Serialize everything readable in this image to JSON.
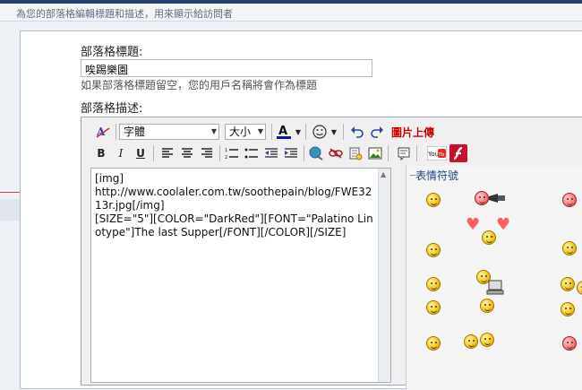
{
  "header": {
    "description": "為您的部落格編輯標題和描述，用來顯示給訪問者"
  },
  "form": {
    "title_label": "部落格標題:",
    "title_value": "唉踢樂園",
    "title_hint": "如果部落格標題留空，您的用戶名稱將會作為標題",
    "desc_label": "部落格描述:"
  },
  "toolbar": {
    "font_value": "字體",
    "size_value": "大小",
    "image_upload": "圖片上傳",
    "bold": "B",
    "italic": "I",
    "underline": "U",
    "font_color_glyph": "A"
  },
  "editor": {
    "content": "[img]\nhttp://www.coolaler.com.tw/soothepain/blog/FWE3213r.jpg[/img]\n[SIZE=\"5\"][COLOR=\"DarkRed\"][FONT=\"Palatino Linotype\"]The last Supper[/FONT][/COLOR][/SIZE]"
  },
  "emoticons": {
    "title": "表情符號"
  },
  "icons": {
    "spell": "spellcheck-icon",
    "undo": "undo-icon",
    "redo": "redo-icon",
    "smiley": "smiley-icon",
    "youtube": "youtube-icon",
    "flash": "flash-icon"
  },
  "colors": {
    "topbar": "#24406c",
    "accent_red": "#cc0000",
    "font_color_bar": "#0a1a9a"
  }
}
